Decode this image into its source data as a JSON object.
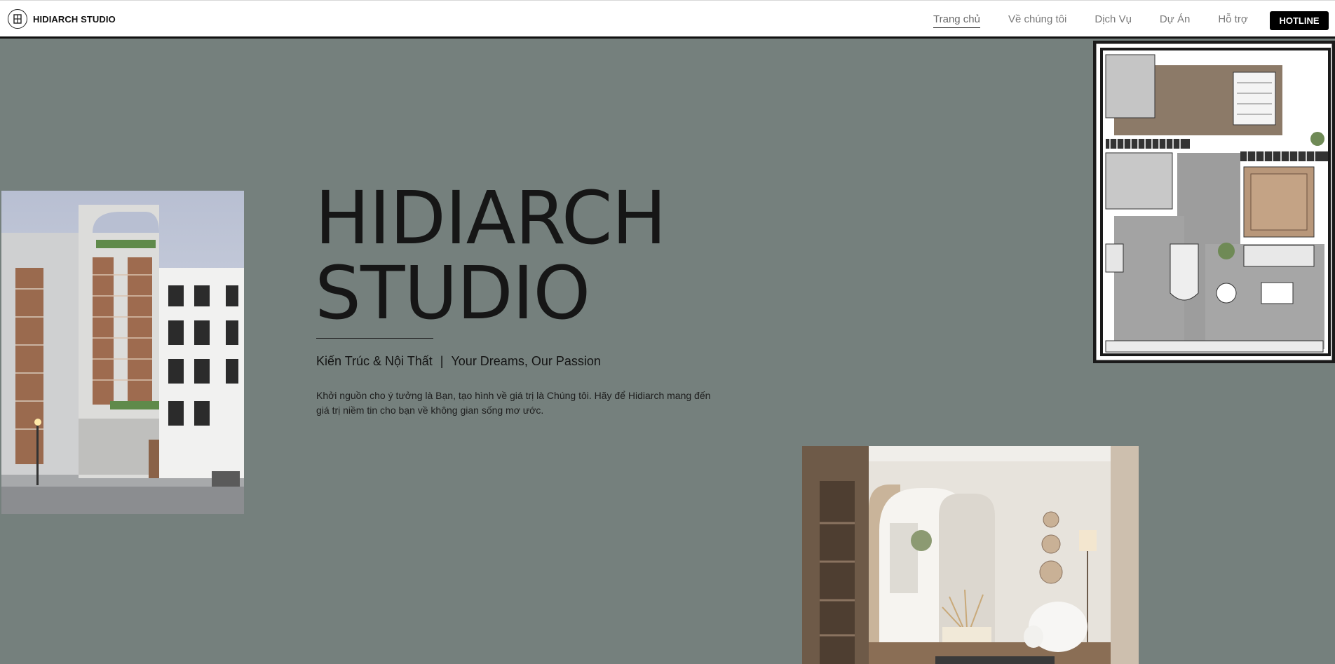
{
  "brand": {
    "name": "HIDIARCH STUDIO",
    "logo_icon": "hidiarch-logo-icon"
  },
  "nav": {
    "items": [
      {
        "label": "Trang chủ",
        "active": true
      },
      {
        "label": "Về chúng tôi",
        "active": false
      },
      {
        "label": "Dịch Vụ",
        "active": false
      },
      {
        "label": "Dự Án",
        "active": false
      },
      {
        "label": "Hỗ trợ",
        "active": false
      }
    ],
    "hotline_label": "HOTLINE"
  },
  "hero": {
    "title_line1": "HIDIARCH",
    "title_line2": "STUDIO",
    "tagline_left": "Kiến Trúc & Nội Thất",
    "tagline_separator": "|",
    "tagline_right": "Your Dreams, Our Passion",
    "description": "Khởi nguồn cho ý tưởng là Bạn, tạo hình về giá trị là Chúng tôi. Hãy để Hidiarch mang đến giá trị niềm tin cho bạn về không gian sống mơ ước."
  },
  "colors": {
    "background": "#75807d",
    "header_bg": "#ffffff",
    "hotline_bg": "#000000",
    "text_dark": "#161616"
  }
}
